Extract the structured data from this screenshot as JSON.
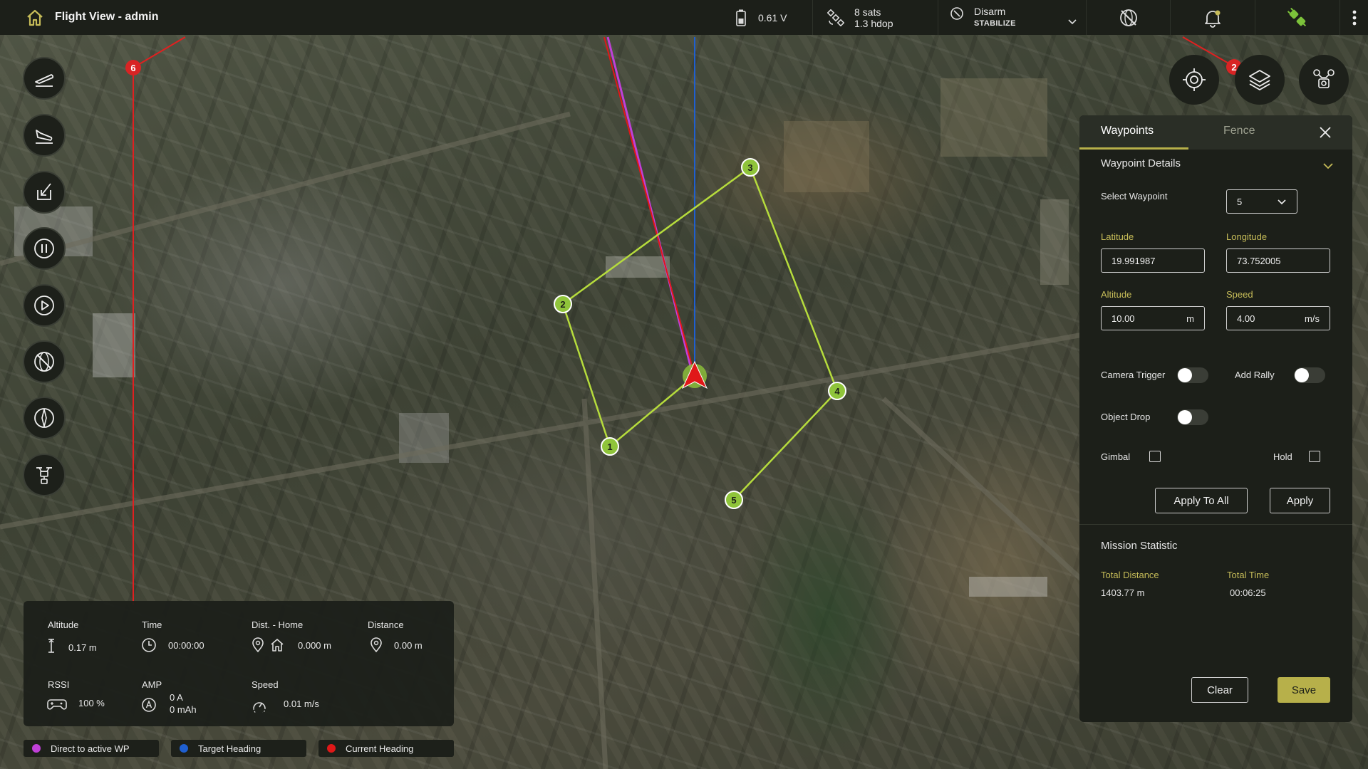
{
  "topbar": {
    "title": "Flight View - admin",
    "voltage": "0.61 V",
    "sats": "8 sats",
    "hdop": "1.3 hdop",
    "arm_state": "Disarm",
    "flight_mode": "STABILIZE"
  },
  "map": {
    "waypoints": [
      "1",
      "2",
      "3",
      "4",
      "5"
    ],
    "rally_markers": [
      "6",
      "2"
    ]
  },
  "telemetry": {
    "altitude_label": "Altitude",
    "altitude_value": "0.17 m",
    "time_label": "Time",
    "time_value": "00:00:00",
    "dist_home_label": "Dist. - Home",
    "dist_home_value": "0.000 m",
    "distance_label": "Distance",
    "distance_value": "0.00 m",
    "rssi_label": "RSSI",
    "rssi_value": "100 %",
    "amp_label": "AMP",
    "amp_value": "0 A",
    "mah_value": "0 mAh",
    "speed_label": "Speed",
    "speed_value": "0.01 m/s"
  },
  "legend": [
    {
      "label": "Direct to active WP",
      "color": "#c040d8"
    },
    {
      "label": "Target Heading",
      "color": "#1f5fd0"
    },
    {
      "label": "Current Heading",
      "color": "#e01818"
    }
  ],
  "panel": {
    "tab_waypoints": "Waypoints",
    "tab_fence": "Fence",
    "section_title": "Waypoint Details",
    "select_label": "Select Waypoint",
    "selected_waypoint": "5",
    "latitude_label": "Latitude",
    "latitude_value": "19.991987",
    "longitude_label": "Longitude",
    "longitude_value": "73.752005",
    "altitude_label": "Altitude",
    "altitude_value": "10.00",
    "altitude_unit": "m",
    "speed_label": "Speed",
    "speed_value": "4.00",
    "speed_unit": "m/s",
    "camera_trigger_label": "Camera Trigger",
    "add_rally_label": "Add Rally",
    "object_drop_label": "Object Drop",
    "gimbal_label": "Gimbal",
    "hold_label": "Hold",
    "apply_all_label": "Apply To All",
    "apply_label": "Apply",
    "stats_title": "Mission Statistic",
    "total_distance_label": "Total Distance",
    "total_distance_value": "1403.77 m",
    "total_time_label": "Total Time",
    "total_time_value": "00:06:25",
    "clear_label": "Clear",
    "save_label": "Save"
  },
  "colors": {
    "accent": "#b7b04a",
    "waypoint": "#8fc43a",
    "route": "#b6dc3c",
    "vehicle": "#e01818"
  }
}
